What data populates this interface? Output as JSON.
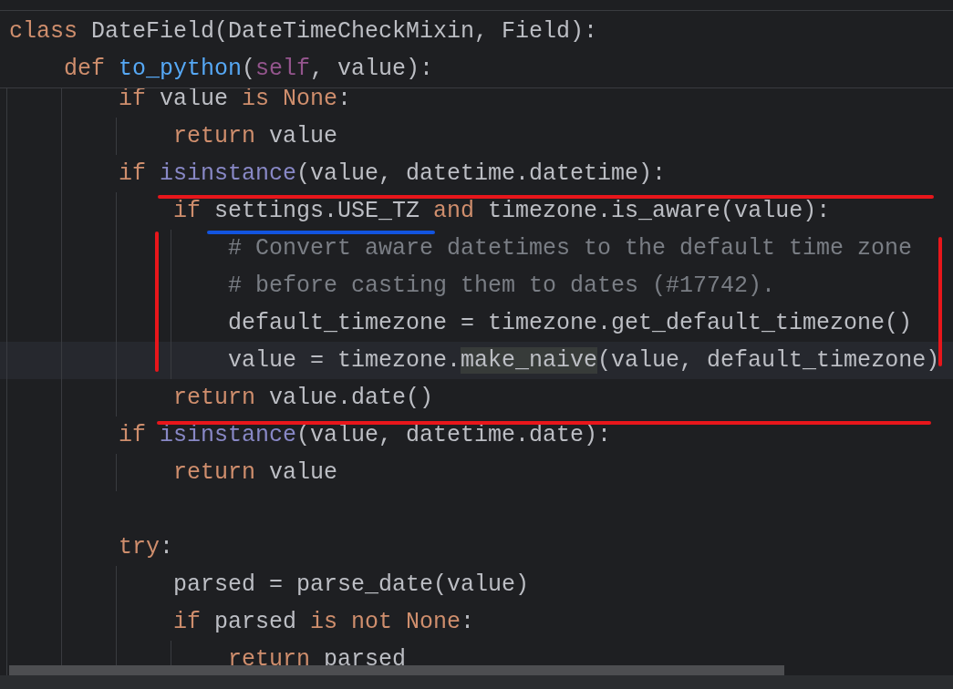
{
  "code": [
    {
      "tokens": [
        {
          "kind": "keyword",
          "text": "class"
        },
        {
          "kind": "plain",
          "text": " DateField(DateTimeCheckMixin, Field):"
        }
      ],
      "children": [
        {
          "tokens": [
            {
              "kind": "keyword",
              "text": "def "
            },
            {
              "kind": "function",
              "text": "to_python"
            },
            {
              "kind": "plain",
              "text": "("
            },
            {
              "kind": "self",
              "text": "self"
            },
            {
              "kind": "plain",
              "text": ", value):"
            }
          ],
          "children": [
            {
              "current": false,
              "tokens": [
                {
                  "kind": "keyword",
                  "text": "if"
                },
                {
                  "kind": "plain",
                  "text": " value "
                },
                {
                  "kind": "keyword",
                  "text": "is None"
                },
                {
                  "kind": "plain",
                  "text": ":"
                }
              ],
              "children": [
                {
                  "current": false,
                  "tokens": [
                    {
                      "kind": "keyword",
                      "text": "return"
                    },
                    {
                      "kind": "plain",
                      "text": " value"
                    }
                  ]
                }
              ]
            },
            {
              "current": false,
              "tokens": [
                {
                  "kind": "keyword",
                  "text": "if "
                },
                {
                  "kind": "builtin",
                  "text": "isinstance"
                },
                {
                  "kind": "plain",
                  "text": "(value, datetime.datetime):"
                }
              ],
              "children": [
                {
                  "current": false,
                  "tokens": [
                    {
                      "kind": "keyword",
                      "text": "if"
                    },
                    {
                      "kind": "plain",
                      "text": " settings.USE_TZ "
                    },
                    {
                      "kind": "keyword",
                      "text": "and"
                    },
                    {
                      "kind": "plain",
                      "text": " timezone.is_aware(value):"
                    }
                  ],
                  "children": [
                    {
                      "current": false,
                      "tokens": [
                        {
                          "kind": "comment",
                          "text": "# Convert aware datetimes to the default time zone"
                        }
                      ]
                    },
                    {
                      "current": false,
                      "tokens": [
                        {
                          "kind": "comment",
                          "text": "# before casting them to dates (#17742)."
                        }
                      ]
                    },
                    {
                      "current": false,
                      "tokens": [
                        {
                          "kind": "plain",
                          "text": "default_timezone = timezone.get_default_timezone()"
                        }
                      ]
                    },
                    {
                      "current": true,
                      "tokens": [
                        {
                          "kind": "plain",
                          "text": "value = timezone."
                        },
                        {
                          "kind": "usage",
                          "text": "make_naive"
                        },
                        {
                          "kind": "plain",
                          "text": "(value, default_timezone)"
                        }
                      ]
                    }
                  ]
                },
                {
                  "current": false,
                  "tokens": [
                    {
                      "kind": "keyword",
                      "text": "return"
                    },
                    {
                      "kind": "plain",
                      "text": " value.date()"
                    }
                  ]
                }
              ]
            },
            {
              "current": false,
              "tokens": [
                {
                  "kind": "keyword",
                  "text": "if "
                },
                {
                  "kind": "builtin",
                  "text": "isinstance"
                },
                {
                  "kind": "plain",
                  "text": "(value, datetime.date):"
                }
              ],
              "children": [
                {
                  "current": false,
                  "tokens": [
                    {
                      "kind": "keyword",
                      "text": "return"
                    },
                    {
                      "kind": "plain",
                      "text": " value"
                    }
                  ]
                }
              ]
            },
            {
              "current": false
            },
            {
              "current": false,
              "tokens": [
                {
                  "kind": "keyword",
                  "text": "try"
                },
                {
                  "kind": "plain",
                  "text": ":"
                }
              ],
              "children": [
                {
                  "current": false,
                  "tokens": [
                    {
                      "kind": "plain",
                      "text": "parsed = parse_date(value)"
                    }
                  ]
                },
                {
                  "current": false,
                  "tokens": [
                    {
                      "kind": "keyword",
                      "text": "if"
                    },
                    {
                      "kind": "plain",
                      "text": " parsed "
                    },
                    {
                      "kind": "keyword",
                      "text": "is not None"
                    },
                    {
                      "kind": "plain",
                      "text": ":"
                    }
                  ],
                  "children": [
                    {
                      "current": false,
                      "tokens": [
                        {
                          "kind": "keyword",
                          "text": "return"
                        },
                        {
                          "kind": "plain",
                          "text": " parsed"
                        }
                      ]
                    }
                  ]
                }
              ]
            }
          ]
        }
      ]
    }
  ]
}
